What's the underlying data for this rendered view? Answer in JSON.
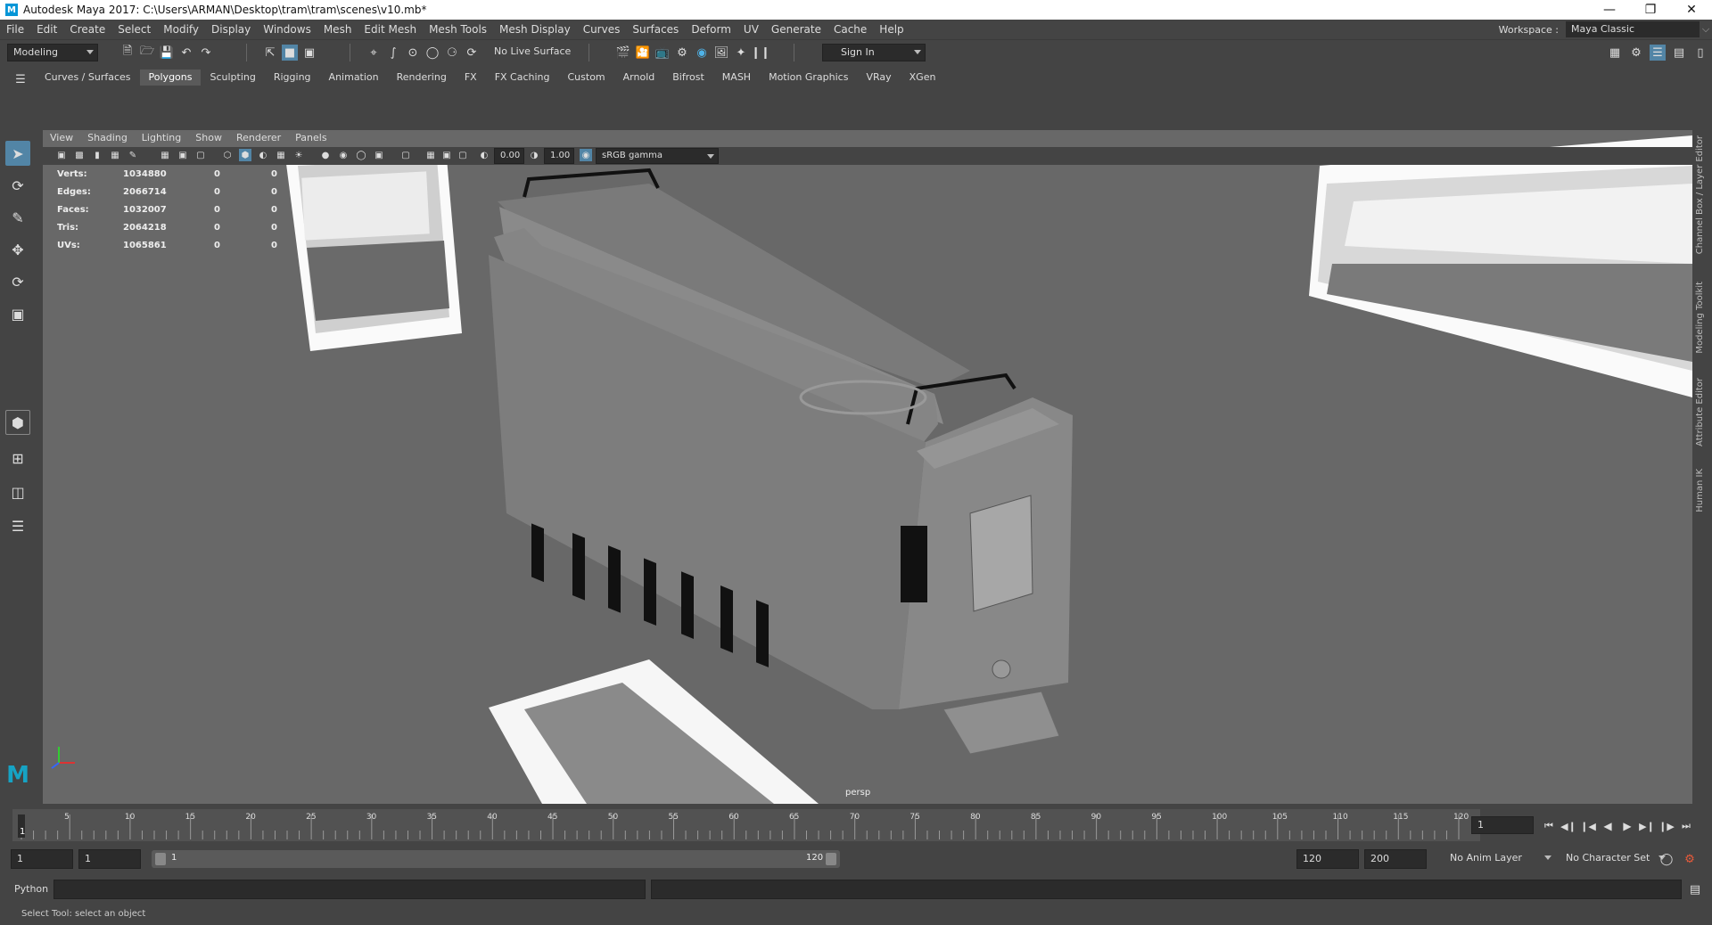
{
  "window": {
    "title": "Autodesk Maya 2017: C:\\Users\\ARMAN\\Desktop\\tram\\tram\\scenes\\v10.mb*",
    "logo_letter": "M"
  },
  "menu": [
    "File",
    "Edit",
    "Create",
    "Select",
    "Modify",
    "Display",
    "Windows",
    "Mesh",
    "Edit Mesh",
    "Mesh Tools",
    "Mesh Display",
    "Curves",
    "Surfaces",
    "Deform",
    "UV",
    "Generate",
    "Cache",
    "Help"
  ],
  "workspace": {
    "label": "Workspace :",
    "value": "Maya Classic"
  },
  "status_line": {
    "menuset": "Modeling",
    "live_surface": "No Live Surface",
    "sign_in": "Sign In"
  },
  "shelf_tabs": [
    "Curves / Surfaces",
    "Polygons",
    "Sculpting",
    "Rigging",
    "Animation",
    "Rendering",
    "FX",
    "FX Caching",
    "Custom",
    "Arnold",
    "Bifrost",
    "MASH",
    "Motion Graphics",
    "VRay",
    "XGen"
  ],
  "active_shelf": "Polygons",
  "viewport": {
    "menus": [
      "View",
      "Shading",
      "Lighting",
      "Show",
      "Renderer",
      "Panels"
    ],
    "exposure": "0.00",
    "gamma": "1.00",
    "color_space": "sRGB gamma",
    "camera": "persp",
    "hud": [
      {
        "label": "Verts:",
        "value": "1034880",
        "sel": "0",
        "comp": "0"
      },
      {
        "label": "Edges:",
        "value": "2066714",
        "sel": "0",
        "comp": "0"
      },
      {
        "label": "Faces:",
        "value": "1032007",
        "sel": "0",
        "comp": "0"
      },
      {
        "label": "Tris:",
        "value": "2064218",
        "sel": "0",
        "comp": "0"
      },
      {
        "label": "UVs:",
        "value": "1065861",
        "sel": "0",
        "comp": "0"
      }
    ]
  },
  "right_tabs": [
    "Channel Box / Layer Editor",
    "Modeling Toolkit",
    "Attribute Editor",
    "Human IK"
  ],
  "timeline": {
    "ticks": [
      "5",
      "10",
      "15",
      "20",
      "25",
      "30",
      "35",
      "40",
      "45",
      "50",
      "55",
      "60",
      "65",
      "70",
      "75",
      "80",
      "85",
      "90",
      "95",
      "100",
      "105",
      "110",
      "115",
      "120"
    ],
    "current_marker": "1",
    "current_frame": "1"
  },
  "range": {
    "start": "1",
    "start2": "1",
    "slider_start": "1",
    "slider_end": "120",
    "end": "120",
    "end2": "200",
    "anim_layer": "No Anim Layer",
    "char_set": "No Character Set"
  },
  "command_line": {
    "language": "Python"
  },
  "help_line": "Select Tool: select an object",
  "colors": {
    "accent": "#5285a6",
    "shelf_orange": "#e8973a",
    "shelf_green": "#3fae6a"
  }
}
